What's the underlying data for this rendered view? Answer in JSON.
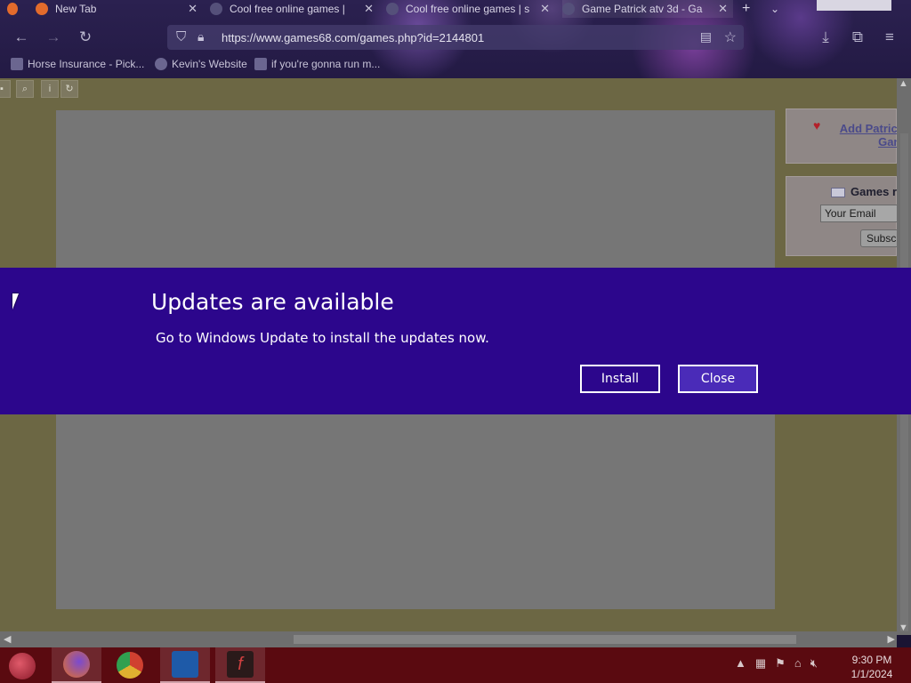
{
  "browser": {
    "tabs": [
      {
        "label": "New Tab",
        "active": false
      },
      {
        "label": "Cool free online games |",
        "active": false
      },
      {
        "label": "Cool free online games | s",
        "active": false
      },
      {
        "label": "Game Patrick atv 3d - Ga",
        "active": true
      }
    ],
    "url": "https://www.games68.com/games.php?id=2144801",
    "bookmarks": [
      "Horse Insurance - Pick...",
      "Kevin's Website",
      "if you're gonna run m..."
    ]
  },
  "page": {
    "favorite_link": "Add Patrick Gam",
    "favorite_link_line1": "Add Patrick",
    "favorite_link_line2": "Gam",
    "subscribe_title": "Games r",
    "email_placeholder": "Your Email",
    "subscribe_button": "Subsc"
  },
  "banner": {
    "title": "Updates are available",
    "message": "Go to Windows Update to install the updates now.",
    "install_label": "Install",
    "close_label": "Close",
    "background_color": "#2c068c"
  },
  "taskbar": {
    "apps": [
      "firefox",
      "chrome",
      "outlook",
      "flash"
    ],
    "time": "9:30 PM",
    "date": "1/1/2024"
  }
}
